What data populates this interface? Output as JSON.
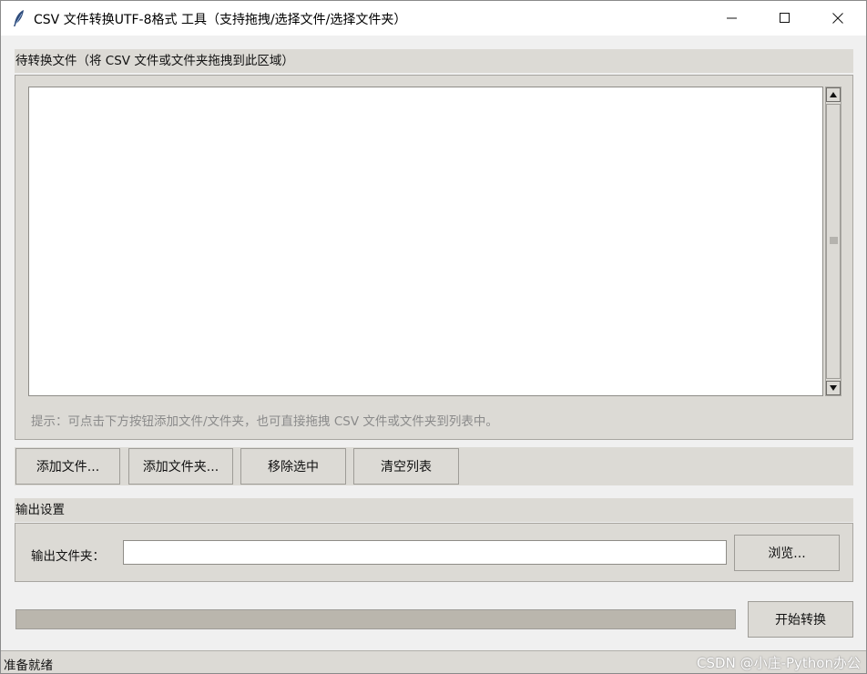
{
  "window": {
    "title": "CSV 文件转换UTF-8格式 工具（支持拖拽/选择文件/选择文件夹）"
  },
  "files_section": {
    "label": "待转换文件（将 CSV 文件或文件夹拖拽到此区域）",
    "items": [],
    "hint": "提示：可点击下方按钮添加文件/文件夹，也可直接拖拽 CSV 文件或文件夹到列表中。"
  },
  "buttons": {
    "add_files": "添加文件...",
    "add_folder": "添加文件夹...",
    "remove_selected": "移除选中",
    "clear_list": "清空列表"
  },
  "output": {
    "section_label": "输出设置",
    "folder_label": "输出文件夹：",
    "folder_value": "",
    "browse": "浏览..."
  },
  "progress": {
    "value": 0
  },
  "start_button": "开始转换",
  "status": {
    "text": "准备就绪"
  },
  "watermark": "CSDN @小庄-Python办公",
  "colors": {
    "panel": "#dcdad5",
    "window_bg": "#f0f0f0",
    "hint_text": "#8a8a8a",
    "progress_trough": "#bab6ad"
  }
}
